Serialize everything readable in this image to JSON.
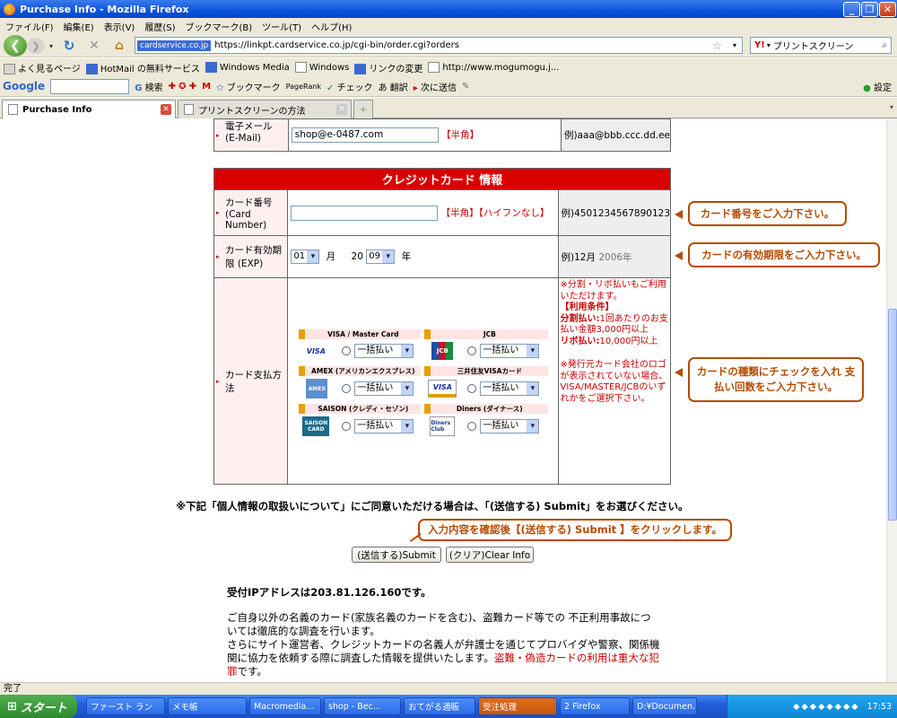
{
  "window": {
    "title": "Purchase Info - Mozilla Firefox"
  },
  "menu": [
    "ファイル(F)",
    "編集(E)",
    "表示(V)",
    "履歴(S)",
    "ブックマーク(B)",
    "ツール(T)",
    "ヘルプ(H)"
  ],
  "nav": {
    "site_label": "cardservice.co.jp",
    "url": "https://linkpt.cardservice.co.jp/cgi-bin/order.cgi?orders",
    "search_text": "プリントスクリーン"
  },
  "bookmarks": [
    "よく見るページ",
    "HotMail の無料サービス",
    "Windows Media",
    "Windows",
    "リンクの変更",
    "http://www.mogumogu.j..."
  ],
  "googlebar": {
    "logo": "Google",
    "items": [
      "検索",
      "ブックマーク",
      "PageRank",
      "チェック",
      "翻訳",
      "次に送信"
    ],
    "settings": "設定"
  },
  "tabs": [
    {
      "label": "Purchase Info"
    },
    {
      "label": "プリントスクリーンの方法"
    }
  ],
  "email_row": {
    "label": "電子メール (E-Mail)",
    "value": "shop@e-0487.com",
    "note": "【半角】",
    "example": "例)aaa@bbb.ccc.dd.ee"
  },
  "card_section": {
    "header": "クレジットカード 情報",
    "number": {
      "label": "カード番号 (Card Number)",
      "note": "【半角】【ハイフンなし】",
      "example": "例)4501234567890123"
    },
    "expiry": {
      "label": "カード有効期限 (EXP)",
      "month": "01",
      "month_unit": "月",
      "year_prefix": "20",
      "year": "09",
      "year_unit": "年",
      "example_prefix": "例)12月",
      "example_year": "2006年"
    },
    "payment": {
      "label": "カード支払方法",
      "brands": [
        {
          "name": "VISA / Master Card",
          "logo": "VISA",
          "option": "一括払い"
        },
        {
          "name": "JCB",
          "logo": "JCB",
          "option": "一括払い"
        },
        {
          "name": "AMEX (アメリカンエクスプレス)",
          "logo": "AMEX",
          "option": "一括払い"
        },
        {
          "name": "三井住友VISAカード",
          "logo": "VISA",
          "option": "一括払い"
        },
        {
          "name": "SAISON (クレディ・セゾン)",
          "logo": "SAISON CARD",
          "option": "一括払い"
        },
        {
          "name": "Diners (ダイナース)",
          "logo": "Diners Club",
          "option": "一括払い"
        }
      ],
      "notes": {
        "line1": "※分割・リボ払いもご利用いただけます。",
        "cond_title": "【利用条件】",
        "split_label": "分割払い:",
        "split_text": "1回あたりのお支払い金額3,000円以上",
        "revo_label": "リボ払い:",
        "revo_text": "10,000円以上",
        "issuer": "※発行元カード会社のロゴが表示されていない場合、VISA/MASTER/JCBのいずれかをご選択下さい。"
      }
    }
  },
  "callouts": {
    "card_number": "カード番号をご入力下さい。",
    "expiry": "カードの有効期限をご入力下さい。",
    "payment": "カードの種類にチェックを入れ 支払い回数をご入力下さい。",
    "submit": "入力内容を確認後【(送信する) Submit 】をクリックします。"
  },
  "consent": "※下記「個人情報の取扱いについて」にご同意いただける場合は、「(送信する) Submit」をお選びください。",
  "buttons": {
    "submit": "(送信する)Submit",
    "clear": "(クリア)Clear Info"
  },
  "ip_text": "受付IPアドレスは203.81.126.160です。",
  "disclaimer": {
    "p1": "ご自身以外の名義のカード(家族名義のカードを含む)、盗難カード等での 不正利用事故については徹底的な調査を行います。",
    "p2": "さらにサイト運営者、クレジットカードの名義人が弁護士を通じてプロバイダや警察、関係機関に協力を依頼する際に調査した情報を提供いたします。",
    "p2_red": "盗難・偽造カードの利用は重大な犯罪",
    "p2_end": "です。"
  },
  "status": "完了",
  "taskbar": {
    "start": "スタート",
    "tasks": [
      "ファースト ラン",
      "メモ帳",
      "Macromedia...",
      "shop - Bec...",
      "おてがる通販",
      "受注処理",
      "2 Firefox",
      "D:¥Documen..."
    ],
    "clock": "17:53"
  },
  "colors": {
    "header_red": "#d90000",
    "callout": "#b84a00",
    "label_bg": "#fff0f0",
    "example_bg": "#eeeeee"
  }
}
